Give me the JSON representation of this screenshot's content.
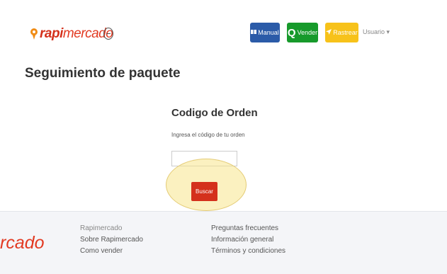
{
  "header": {
    "logo": {
      "bold": "rapi",
      "light": "mercado"
    },
    "nav": {
      "manual": "Manual",
      "vender": "Vender",
      "rastrear": "Rastrear",
      "user": "Usuario ▾"
    }
  },
  "page": {
    "title": "Seguimiento de paquete"
  },
  "form": {
    "title": "Codigo de Orden",
    "hint": "Ingresa el código de tu orden",
    "input_value": "",
    "button": "Buscar"
  },
  "footer": {
    "logo": "rcado",
    "col1": [
      "Rapimercado",
      "Sobre Rapimercado",
      "Como vender"
    ],
    "col2": [
      "Preguntas frecuentes",
      "Información general",
      "Términos y condiciones"
    ]
  },
  "colors": {
    "brand": "#d4311c",
    "manual": "#2b5ba8",
    "vender": "#179a2b",
    "rastrear": "#f7c21a",
    "highlight": "#f7e58c"
  },
  "icons": [
    "pin-icon",
    "globe-icon",
    "book-icon",
    "search-icon",
    "location-arrow-icon",
    "caret-down-icon"
  ]
}
